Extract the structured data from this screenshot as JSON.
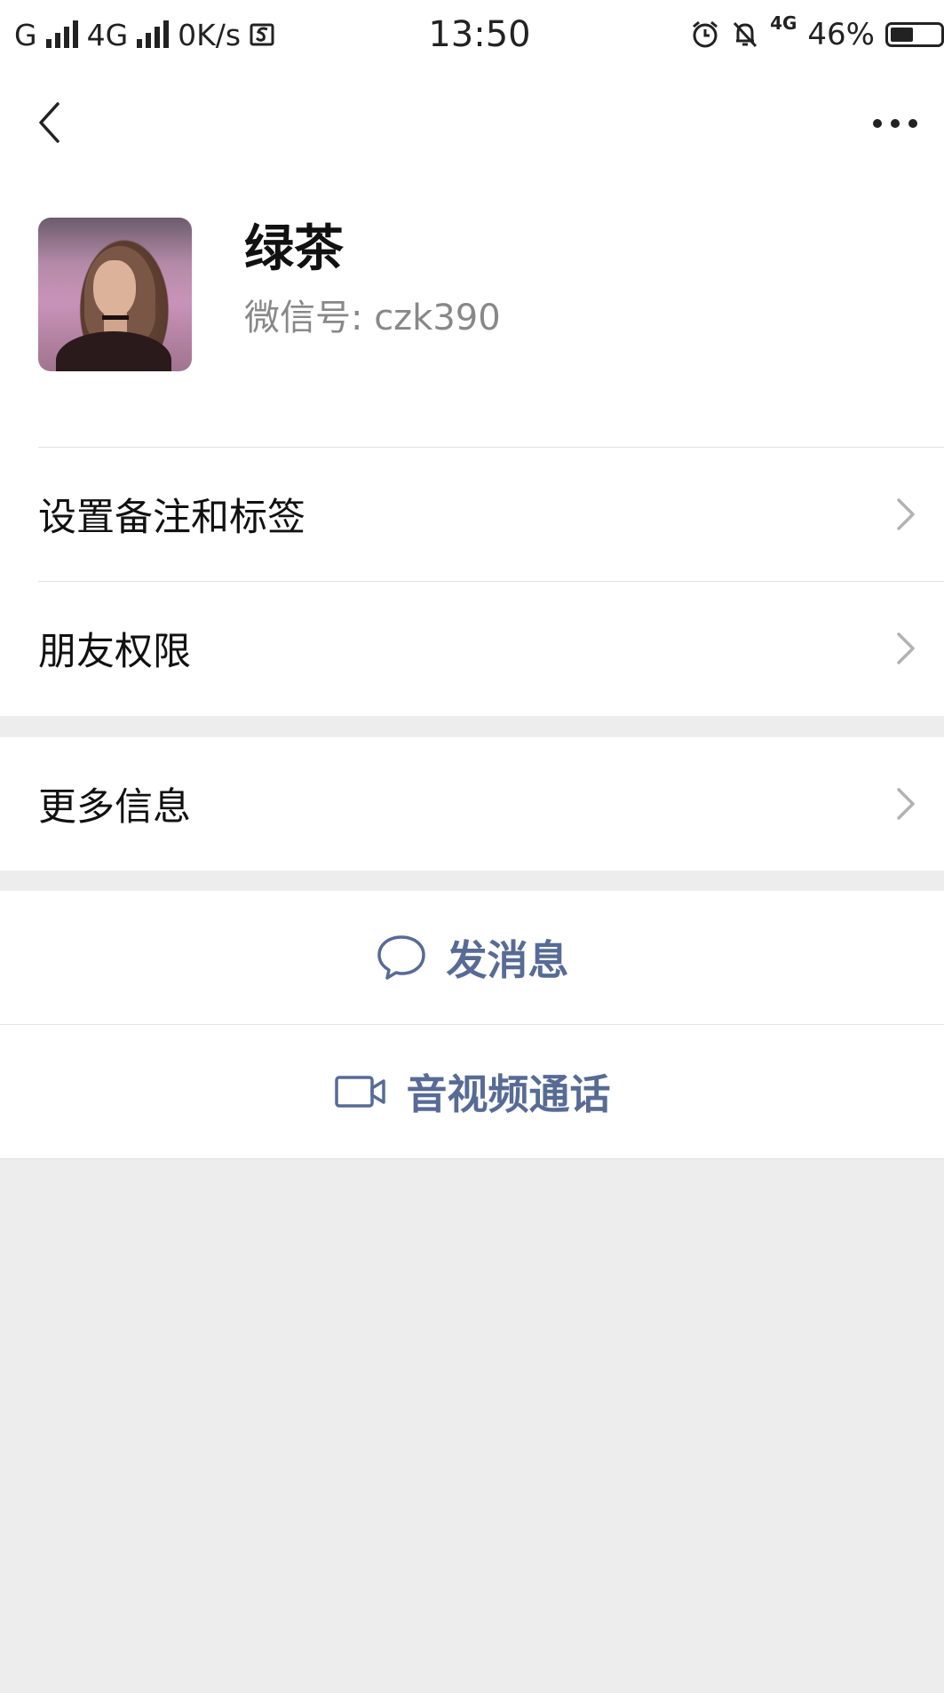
{
  "status_bar": {
    "carrier_left": "G",
    "network": "4G",
    "speed": "0K/s",
    "time": "13:50",
    "network_right": "4G",
    "battery_percent": "46%",
    "battery_level": 0.46
  },
  "profile": {
    "name": "绿茶",
    "wechat_id": "微信号: czk390"
  },
  "menu": {
    "items": [
      {
        "label": "设置备注和标签"
      },
      {
        "label": "朋友权限"
      },
      {
        "label": "更多信息"
      }
    ]
  },
  "actions": {
    "send_message": "发消息",
    "video_call": "音视频通话"
  },
  "colors": {
    "accent": "#576b95",
    "background": "#ededed",
    "surface": "#ffffff"
  },
  "icons": {
    "back": "chevron-left-icon",
    "more": "more-dots-icon",
    "row_chevron": "chevron-right-icon",
    "message": "chat-bubble-icon",
    "video": "video-camera-icon"
  }
}
